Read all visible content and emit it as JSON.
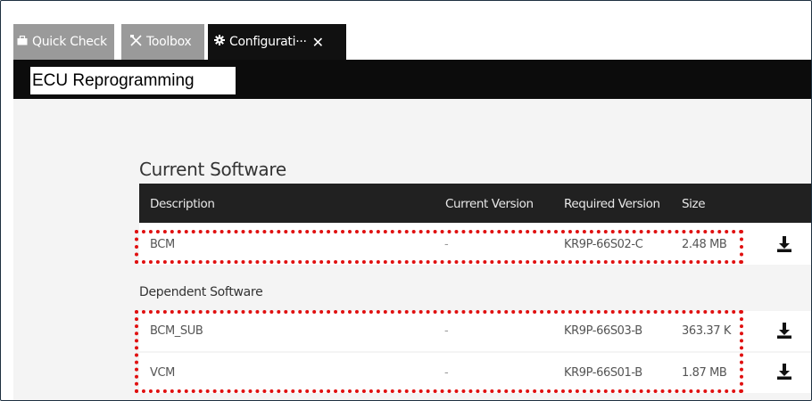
{
  "tabs": [
    {
      "label": "Quick Check",
      "icon": "briefcase-icon",
      "active": false
    },
    {
      "label": "Toolbox",
      "icon": "tools-icon",
      "active": false
    },
    {
      "label": "Configurati···",
      "icon": "gear-icon",
      "active": true,
      "close": "✕"
    }
  ],
  "header": {
    "title": "ECU Reprogramming"
  },
  "current_software": {
    "title": "Current Software",
    "columns": [
      "Description",
      "Current Version",
      "Required Version",
      "Size"
    ],
    "rows": [
      {
        "description": "BCM",
        "current_version": "-",
        "required_version": "KR9P-66S02-C",
        "size": "2.48 MB",
        "action_icon": "download-icon"
      }
    ]
  },
  "dependent_software": {
    "title": "Dependent Software",
    "rows": [
      {
        "description": "BCM_SUB",
        "current_version": "-",
        "required_version": "KR9P-66S03-B",
        "size": "363.37 K",
        "action_icon": "download-icon"
      },
      {
        "description": "VCM",
        "current_version": "-",
        "required_version": "KR9P-66S01-B",
        "size": "1.87 MB",
        "action_icon": "download-icon"
      }
    ]
  },
  "colors": {
    "header_bg": "#0c0c0c",
    "table_head_bg": "#212121",
    "highlight": "#e01010",
    "tab_inactive": "#9a9a9a"
  }
}
